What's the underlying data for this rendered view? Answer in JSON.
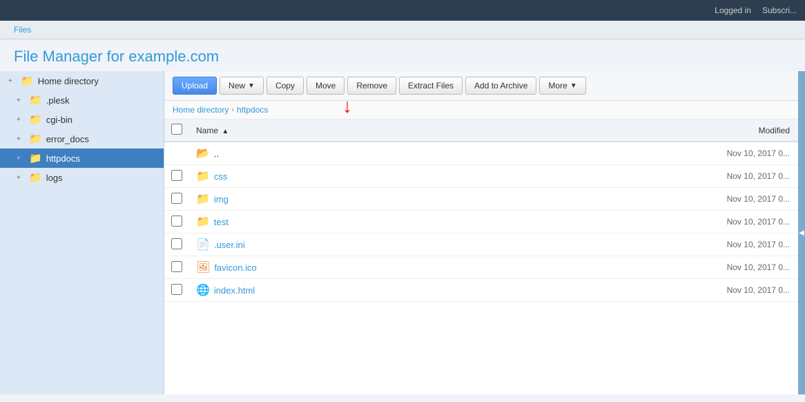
{
  "topbar": {
    "logged_in": "Logged in",
    "subscribe": "Subscri..."
  },
  "breadcrumb_top": {
    "label": "Files"
  },
  "page_title": {
    "prefix": "File Manager for ",
    "domain": "example.com"
  },
  "toolbar": {
    "upload": "Upload",
    "new": "New",
    "copy": "Copy",
    "move": "Move",
    "remove": "Remove",
    "extract": "Extract Files",
    "add_to_archive": "Add to Archive",
    "more": "More"
  },
  "breadcrumb_nav": {
    "home": "Home directory",
    "current": "httpdocs"
  },
  "table": {
    "col_name": "Name",
    "col_modified": "Modified",
    "sort_indicator": "▲"
  },
  "sidebar": {
    "items": [
      {
        "id": "home-directory",
        "label": "Home directory",
        "level": 0,
        "expand": true,
        "icon": "folder"
      },
      {
        "id": "plesk",
        "label": ".plesk",
        "level": 1,
        "expand": true,
        "icon": "folder"
      },
      {
        "id": "cgi-bin",
        "label": "cgi-bin",
        "level": 1,
        "expand": true,
        "icon": "folder"
      },
      {
        "id": "error_docs",
        "label": "error_docs",
        "level": 1,
        "expand": true,
        "icon": "folder"
      },
      {
        "id": "httpdocs",
        "label": "httpdocs",
        "level": 1,
        "expand": true,
        "icon": "folder",
        "active": true
      },
      {
        "id": "logs",
        "label": "logs",
        "level": 1,
        "expand": true,
        "icon": "folder"
      }
    ]
  },
  "files": [
    {
      "id": "parent",
      "name": "..",
      "type": "back",
      "modified": "Nov 10, 2017 0..."
    },
    {
      "id": "css",
      "name": "css",
      "type": "folder",
      "modified": "Nov 10, 2017 0..."
    },
    {
      "id": "img",
      "name": "img",
      "type": "folder",
      "modified": "Nov 10, 2017 0..."
    },
    {
      "id": "test",
      "name": "test",
      "type": "folder",
      "modified": "Nov 10, 2017 0..."
    },
    {
      "id": "user-ini",
      "name": ".user.ini",
      "type": "ini",
      "modified": "Nov 10, 2017 0..."
    },
    {
      "id": "favicon",
      "name": "favicon.ico",
      "type": "ico",
      "modified": "Nov 10, 2017 0..."
    },
    {
      "id": "index-html",
      "name": "index.html",
      "type": "html",
      "modified": "Nov 10, 2017 0..."
    }
  ]
}
